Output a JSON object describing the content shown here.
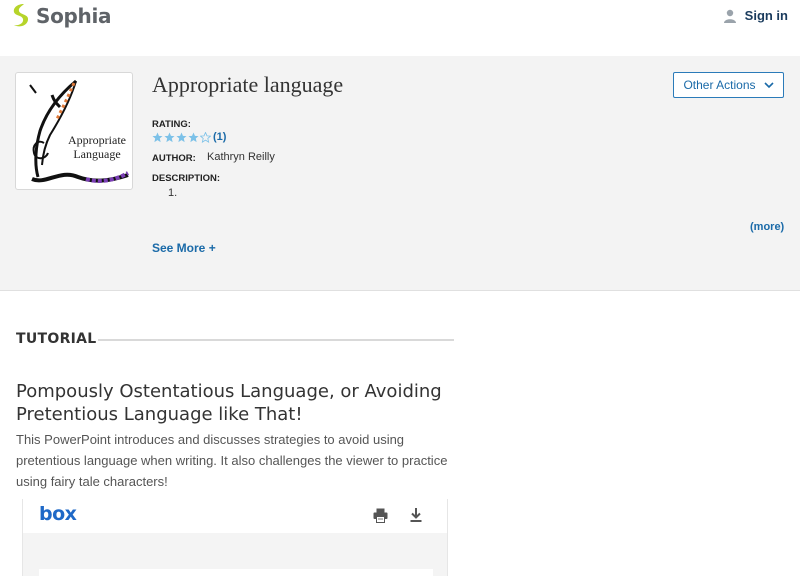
{
  "header": {
    "brand": "Sophia",
    "signin_label": "Sign in",
    "icons": {
      "logo": "sophia-logo-icon",
      "user": "user-icon"
    },
    "colors": {
      "logo_green": "#b6d42a",
      "link": "#1a3b5d"
    }
  },
  "resource": {
    "thumbnail_alt": "Appropriate Language",
    "title": "Appropriate language",
    "other_actions_label": "Other Actions",
    "rating_label": "RATING:",
    "rating_stars": 4,
    "rating_max": 5,
    "rating_count": "(1)",
    "author_label": "AUTHOR:",
    "author_name": "Kathryn Reilly",
    "description_label": "DESCRIPTION:",
    "description_item": "1.",
    "more_label": "(more)",
    "see_more_label": "See More +"
  },
  "tutorial": {
    "section_label": "TUTORIAL",
    "title": "Pompously Ostentatious Language, or Avoiding Pretentious Language like That!",
    "description": "This PowerPoint introduces and discusses strategies to avoid using pretentious language when writing. It also challenges the viewer to practice using fairy tale characters!"
  },
  "viewer": {
    "brand": "box",
    "icons": {
      "print": "print-icon",
      "download": "download-icon"
    }
  }
}
